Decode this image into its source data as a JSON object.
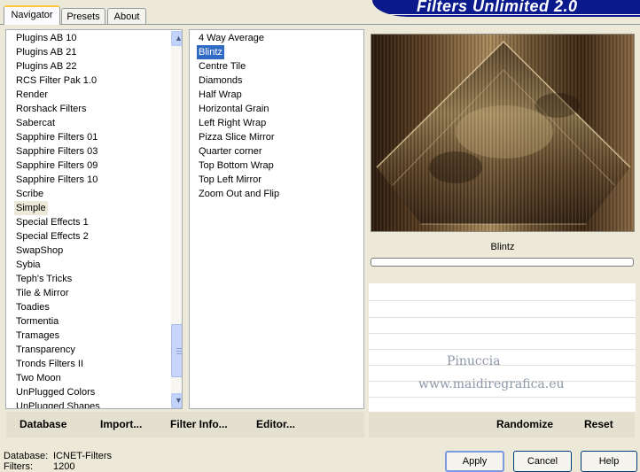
{
  "tabs": [
    "Navigator",
    "Presets",
    "About"
  ],
  "banner_title": "Filters Unlimited 2.0",
  "categories": [
    "Plugins AB 10",
    "Plugins AB 21",
    "Plugins AB 22",
    "RCS Filter Pak 1.0",
    "Render",
    "Rorshack Filters",
    "Sabercat",
    "Sapphire Filters 01",
    "Sapphire Filters 03",
    "Sapphire Filters 09",
    "Sapphire Filters 10",
    "Scribe",
    "Simple",
    "Special Effects 1",
    "Special Effects 2",
    "SwapShop",
    "Sybia",
    "Teph's Tricks",
    "Tile & Mirror",
    "Toadies",
    "Tormentia",
    "Tramages",
    "Transparency",
    "Tronds Filters II",
    "Two Moon",
    "UnPlugged Colors",
    "UnPlugged Shapes"
  ],
  "selected_category": "Simple",
  "filters": [
    "4 Way Average",
    "Blintz",
    "Centre Tile",
    "Diamonds",
    "Half Wrap",
    "Horizontal Grain",
    "Left Right Wrap",
    "Pizza Slice Mirror",
    "Quarter corner",
    "Top Bottom Wrap",
    "Top Left Mirror",
    "Zoom Out and Flip"
  ],
  "selected_filter": "Blintz",
  "preview_caption": "Blintz",
  "progress_fraction": 0,
  "watermark": {
    "line1": "Pinuccia",
    "line2": "www.maidiregrafica.eu"
  },
  "left_actions": {
    "database": "Database",
    "import": "Import...",
    "filter_info": "Filter Info...",
    "editor": "Editor..."
  },
  "right_actions": {
    "randomize": "Randomize",
    "reset": "Reset"
  },
  "status": {
    "database_label": "Database:",
    "database_value": "ICNET-Filters",
    "filters_label": "Filters:",
    "filters_value": "1200"
  },
  "buttons": {
    "apply": "Apply",
    "cancel": "Cancel",
    "help": "Help"
  },
  "colors": {
    "selection": "#316ac5",
    "banner": "#0a1a8c",
    "face": "#ece9d8"
  }
}
